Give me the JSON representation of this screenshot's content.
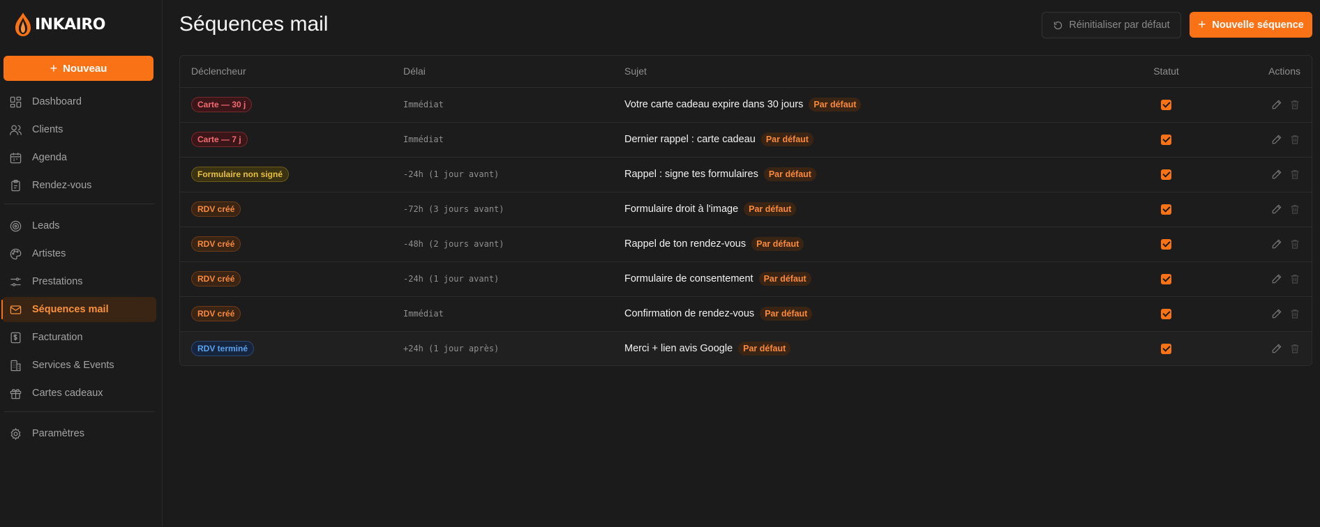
{
  "brand": {
    "name": "INKAIRO",
    "accent": "#f97316"
  },
  "sidebar": {
    "new_button": "Nouveau",
    "groups": [
      [
        {
          "label": "Dashboard",
          "icon": "dashboard-icon"
        },
        {
          "label": "Clients",
          "icon": "users-icon"
        },
        {
          "label": "Agenda",
          "icon": "calendar-icon"
        },
        {
          "label": "Rendez-vous",
          "icon": "clipboard-icon"
        }
      ],
      [
        {
          "label": "Leads",
          "icon": "target-icon"
        },
        {
          "label": "Artistes",
          "icon": "palette-icon"
        },
        {
          "label": "Prestations",
          "icon": "sliders-icon"
        },
        {
          "label": "Séquences mail",
          "icon": "mail-icon",
          "active": true
        },
        {
          "label": "Facturation",
          "icon": "invoice-icon"
        },
        {
          "label": "Services & Events",
          "icon": "building-icon"
        },
        {
          "label": "Cartes cadeaux",
          "icon": "gift-icon"
        }
      ],
      [
        {
          "label": "Paramètres",
          "icon": "gear-icon"
        }
      ]
    ]
  },
  "header": {
    "title": "Séquences mail",
    "reset_button": "Réinitialiser par défaut",
    "new_sequence_button": "Nouvelle séquence"
  },
  "table": {
    "columns": [
      "Déclencheur",
      "Délai",
      "Sujet",
      "Statut",
      "Actions"
    ],
    "rows": [
      {
        "trigger": "Carte — 30 j",
        "trigger_color": "red",
        "delay": "Immédiat",
        "subject": "Votre carte cadeau expire dans 30 jours",
        "badge": "Par défaut",
        "enabled": true
      },
      {
        "trigger": "Carte — 7 j",
        "trigger_color": "red",
        "delay": "Immédiat",
        "subject": "Dernier rappel : carte cadeau",
        "badge": "Par défaut",
        "enabled": true
      },
      {
        "trigger": "Formulaire non signé",
        "trigger_color": "yellow",
        "delay": "-24h (1 jour avant)",
        "subject": "Rappel : signe tes formulaires",
        "badge": "Par défaut",
        "enabled": true
      },
      {
        "trigger": "RDV créé",
        "trigger_color": "orange",
        "delay": "-72h (3 jours avant)",
        "subject": "Formulaire droit à l'image",
        "badge": "Par défaut",
        "enabled": true
      },
      {
        "trigger": "RDV créé",
        "trigger_color": "orange",
        "delay": "-48h (2 jours avant)",
        "subject": "Rappel de ton rendez-vous",
        "badge": "Par défaut",
        "enabled": true
      },
      {
        "trigger": "RDV créé",
        "trigger_color": "orange",
        "delay": "-24h (1 jour avant)",
        "subject": "Formulaire de consentement",
        "badge": "Par défaut",
        "enabled": true
      },
      {
        "trigger": "RDV créé",
        "trigger_color": "orange",
        "delay": "Immédiat",
        "subject": "Confirmation de rendez-vous",
        "badge": "Par défaut",
        "enabled": true
      },
      {
        "trigger": "RDV terminé",
        "trigger_color": "blue",
        "delay": "+24h (1 jour après)",
        "subject": "Merci + lien avis Google",
        "badge": "Par défaut",
        "enabled": true
      }
    ]
  }
}
